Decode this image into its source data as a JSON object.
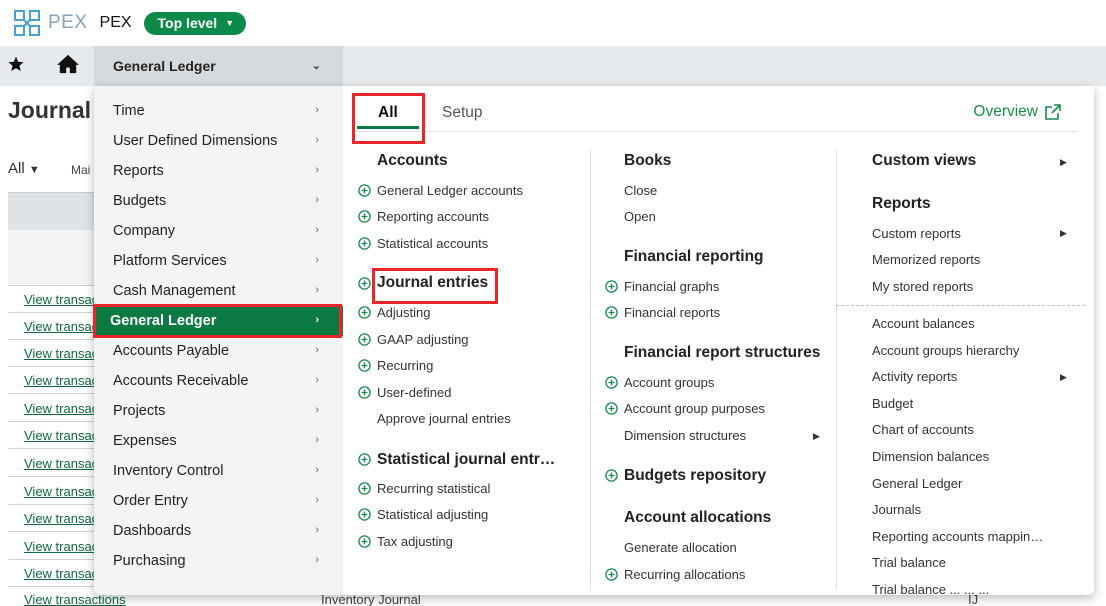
{
  "app": {
    "logo_text": "PEX",
    "company_name": "PEX",
    "level_label": "Top level"
  },
  "nav": {
    "active_module": "General Ledger"
  },
  "background": {
    "page_title": "Journal",
    "view_filter": "All",
    "man_label": "Mai",
    "row_link": "View transactions",
    "bottom_link": "View transactions",
    "bottom_journal": "Inventory Journal",
    "bottom_code": "IJ"
  },
  "left_menu": [
    {
      "label": "Time"
    },
    {
      "label": "User Defined Dimensions"
    },
    {
      "label": "Reports"
    },
    {
      "label": "Budgets"
    },
    {
      "label": "Company"
    },
    {
      "label": "Platform Services"
    },
    {
      "label": "Cash Management"
    },
    {
      "label": "General Ledger"
    },
    {
      "label": "Accounts Payable"
    },
    {
      "label": "Accounts Receivable"
    },
    {
      "label": "Projects"
    },
    {
      "label": "Expenses"
    },
    {
      "label": "Inventory Control"
    },
    {
      "label": "Order Entry"
    },
    {
      "label": "Dashboards"
    },
    {
      "label": "Purchasing"
    }
  ],
  "tabs": {
    "all": "All",
    "setup": "Setup",
    "overview": "Overview"
  },
  "col1": {
    "accounts": {
      "heading": "Accounts",
      "items": [
        "General Ledger accounts",
        "Reporting accounts",
        "Statistical accounts"
      ]
    },
    "journal_entries": {
      "heading": "Journal entries",
      "items": [
        "Adjusting",
        "GAAP adjusting",
        "Recurring",
        "User-defined",
        "Approve journal entries"
      ]
    },
    "statistical": {
      "heading": "Statistical journal entr…",
      "items": [
        "Recurring statistical",
        "Statistical adjusting",
        "Tax adjusting"
      ]
    }
  },
  "col2": {
    "books": {
      "heading": "Books",
      "items": [
        "Close",
        "Open"
      ]
    },
    "financial_reporting": {
      "heading": "Financial reporting",
      "items": [
        "Financial graphs",
        "Financial reports"
      ]
    },
    "structures": {
      "heading": "Financial report structures",
      "items": [
        "Account groups",
        "Account group purposes",
        "Dimension structures"
      ]
    },
    "budgets_repo": {
      "heading": "Budgets repository"
    },
    "allocations": {
      "heading": "Account allocations",
      "items": [
        "Generate allocation",
        "Recurring allocations"
      ]
    }
  },
  "col3": {
    "custom_views": {
      "heading": "Custom views"
    },
    "reports": {
      "heading": "Reports",
      "items": [
        "Custom reports",
        "Memorized reports",
        "My stored reports"
      ]
    },
    "report_list": [
      "Account balances",
      "Account groups hierarchy",
      "Activity reports",
      "Budget",
      "Chart of accounts",
      "Dimension balances",
      "General Ledger",
      "Journals",
      "Reporting accounts mappin…",
      "Trial balance",
      "Trial balance ... ... ..."
    ]
  },
  "colors": {
    "brand_green": "#0b7a42",
    "highlight_red": "#e8262b",
    "link_green": "#1a8a4c"
  }
}
